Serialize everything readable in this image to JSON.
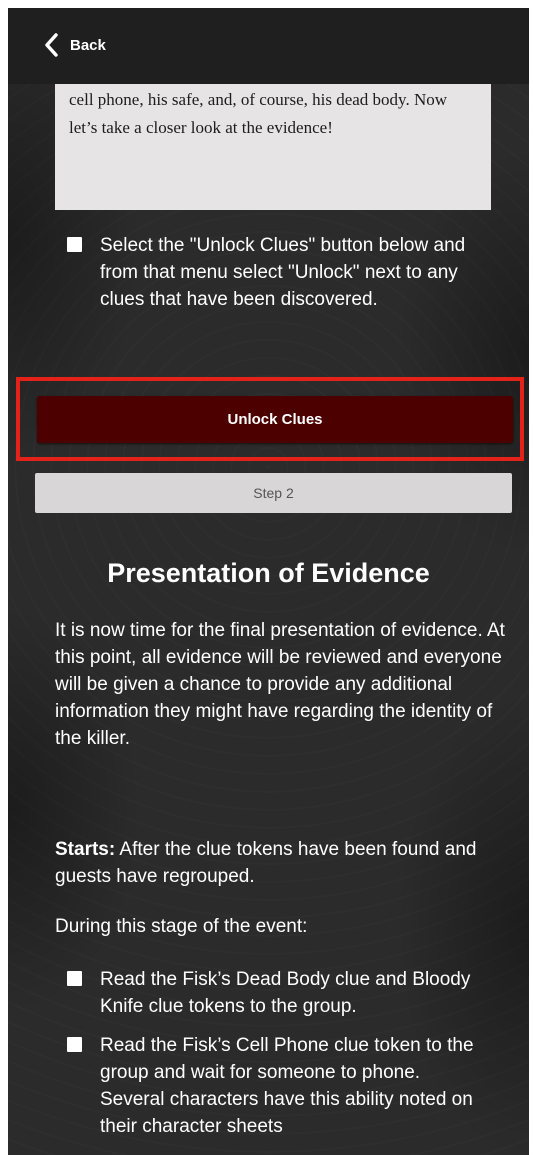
{
  "header": {
    "back_label": "Back",
    "back_icon": "chevron-left-icon"
  },
  "intro_box": {
    "text": "cell phone, his safe, and, of course, his dead body. Now let’s take a closer look at the evidence!"
  },
  "step1_checklist": [
    {
      "text": "Select the \"Unlock Clues\" button below and from that menu select \"Unlock\" next to any clues that have been discovered.",
      "checked": false
    }
  ],
  "unlock_button": {
    "label": "Unlock Clues",
    "color": "#4d0000",
    "highlight_color": "#e32219"
  },
  "step_tab": {
    "label": "Step 2"
  },
  "section": {
    "title": "Presentation of Evidence",
    "body": "It is now time for the final presentation of evidence. At this point, all evidence will be reviewed and everyone will be given a chance to provide any additional information they might have regarding the identity of the killer.",
    "starts_label": "Starts:",
    "starts_text": " After the clue tokens have been found and guests have regrouped.",
    "during_text": "During this stage of the event:",
    "checklist": [
      {
        "text": "Read the Fisk’s Dead Body clue and Bloody Knife clue tokens to the group.",
        "checked": false
      },
      {
        "text": "Read the Fisk’s Cell Phone clue token to the group and wait for someone to phone. Several characters have this ability noted on their character sheets",
        "checked": false
      }
    ]
  }
}
